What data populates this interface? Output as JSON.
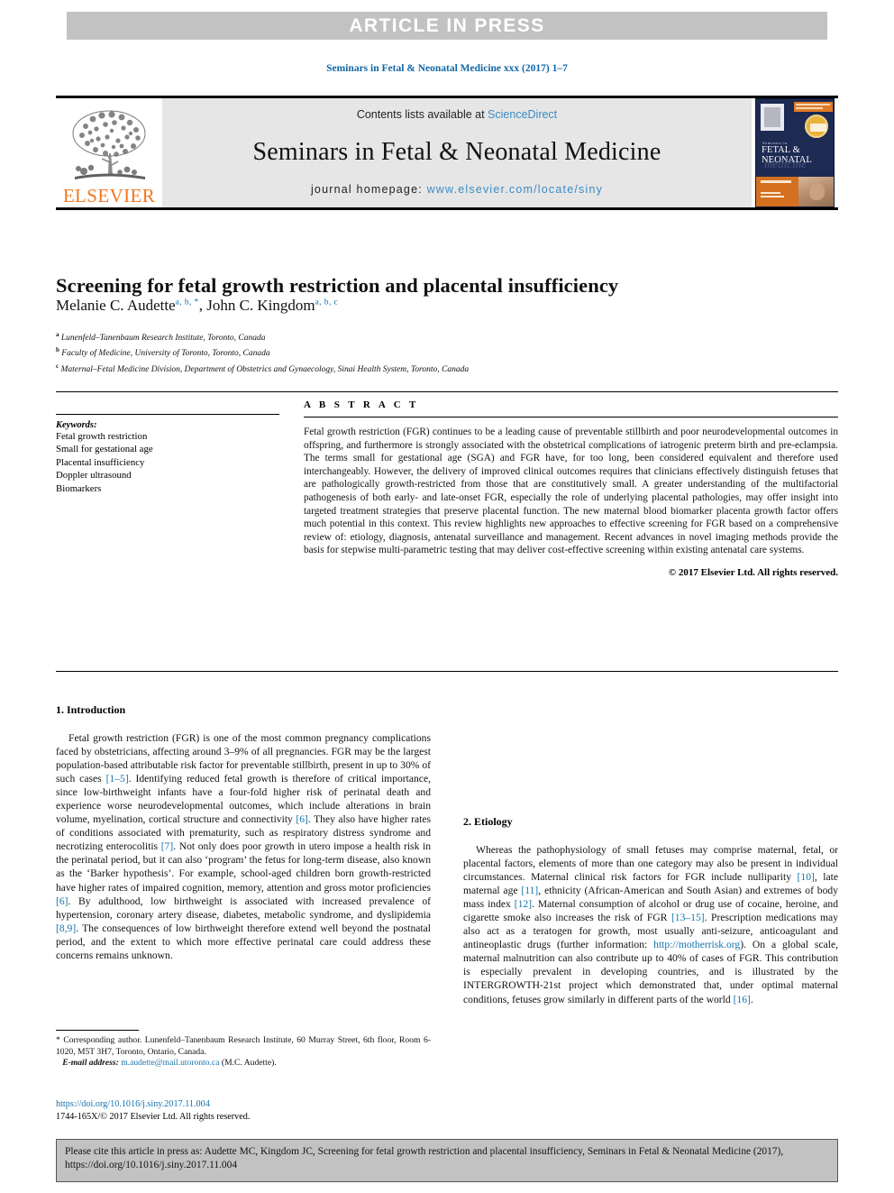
{
  "banner": {
    "label": "ARTICLE IN PRESS"
  },
  "journal_ref": "Seminars in Fetal & Neonatal Medicine xxx (2017) 1–7",
  "masthead": {
    "contents_prefix": "Contents lists available at ",
    "sciencedirect": "ScienceDirect",
    "journal_title": "Seminars in Fetal & Neonatal Medicine",
    "homepage_prefix": "journal homepage: ",
    "homepage_url": "www.elsevier.com/locate/siny",
    "publisher": "ELSEVIER",
    "cover": {
      "superline": "Seminars in",
      "title_line": "FETAL & NEONATAL",
      "script_line": "medicine"
    }
  },
  "article": {
    "title": "Screening for fetal growth restriction and placental insufficiency",
    "authors": [
      {
        "name": "Melanie C. Audette",
        "marks": "a, b, *"
      },
      {
        "name": "John C. Kingdom",
        "marks": "a, b, c"
      }
    ],
    "affiliations": [
      {
        "mark": "a",
        "text": "Lunenfeld–Tanenbaum Research Institute, Toronto, Canada"
      },
      {
        "mark": "b",
        "text": "Faculty of Medicine, University of Toronto, Toronto, Canada"
      },
      {
        "mark": "c",
        "text": "Maternal–Fetal Medicine Division, Department of Obstetrics and Gynaecology, Sinai Health System, Toronto, Canada"
      }
    ]
  },
  "keywords": {
    "heading": "Keywords:",
    "items": [
      "Fetal growth restriction",
      "Small for gestational age",
      "Placental insufficiency",
      "Doppler ultrasound",
      "Biomarkers"
    ]
  },
  "abstract": {
    "heading": "A B S T R A C T",
    "text": "Fetal growth restriction (FGR) continues to be a leading cause of preventable stillbirth and poor neurodevelopmental outcomes in offspring, and furthermore is strongly associated with the obstetrical complications of iatrogenic preterm birth and pre-eclampsia. The terms small for gestational age (SGA) and FGR have, for too long, been considered equivalent and therefore used interchangeably. However, the delivery of improved clinical outcomes requires that clinicians effectively distinguish fetuses that are pathologically growth-restricted from those that are constitutively small. A greater understanding of the multifactorial pathogenesis of both early- and late-onset FGR, especially the role of underlying placental pathologies, may offer insight into targeted treatment strategies that preserve placental function. The new maternal blood biomarker placenta growth factor offers much potential in this context. This review highlights new approaches to effective screening for FGR based on a comprehensive review of: etiology, diagnosis, antenatal surveillance and management. Recent advances in novel imaging methods provide the basis for stepwise multi-parametric testing that may deliver cost-effective screening within existing antenatal care systems.",
    "copyright": "© 2017 Elsevier Ltd. All rights reserved."
  },
  "sections": {
    "intro_heading": "1. Introduction",
    "etiology_heading": "2. Etiology"
  },
  "body": {
    "intro_p1_a": "Fetal growth restriction (FGR) is one of the most common pregnancy complications faced by obstetricians, affecting around 3–9% of all pregnancies. FGR may be the largest population-based attributable risk factor for preventable stillbirth, present in up to 30% of such cases ",
    "intro_p1_ref1": "[1–5]",
    "intro_p1_b": ". Identifying reduced fetal growth is therefore of critical importance, since low-birthweight infants have a four-fold higher risk of perinatal death and experience worse neurodevelopmental outcomes, which include alterations in brain volume, myelination, cortical structure and connectivity ",
    "intro_p1_ref2": "[6]",
    "intro_p1_c": ". They also have higher rates of conditions associated with prematurity, such as respiratory distress syndrome and necrotizing enterocolitis ",
    "intro_p1_ref3": "[7]",
    "intro_p1_d": ". Not only does poor growth in utero impose a health risk in the perinatal period, but it can also ‘program’ the fetus for long-term disease, also known as the ‘Barker hypothesis’. For example, school-aged children born growth-restricted have higher rates of impaired cognition, memory, attention and gross motor proficiencies ",
    "intro_p1_ref4": "[6]",
    "intro_p1_e": ". By adulthood, low birthweight is associated with increased prevalence of hypertension, coronary artery disease, diabetes, metabolic syndrome, and dyslipidemia ",
    "intro_p1_ref5": "[8,9]",
    "intro_p1_f": ". The consequences of low birthweight therefore extend well beyond the postnatal period, and the extent to which more effective perinatal care could address these concerns remains unknown.",
    "etiology_p1_a": "Whereas the pathophysiology of small fetuses may comprise maternal, fetal, or placental factors, elements of more than one category may also be present in individual circumstances. Maternal clinical risk factors for FGR include nulliparity ",
    "etiology_p1_ref1": "[10]",
    "etiology_p1_b": ", late maternal age ",
    "etiology_p1_ref2": "[11]",
    "etiology_p1_c": ", ethnicity (African-American and South Asian) and extremes of body mass index ",
    "etiology_p1_ref3": "[12]",
    "etiology_p1_d": ". Maternal consumption of alcohol or drug use of cocaine, heroine, and cigarette smoke also increases the risk of FGR ",
    "etiology_p1_ref4": "[13–15]",
    "etiology_p1_e": ". Prescription medications may also act as a teratogen for growth, most usually anti-seizure, anticoagulant and antineoplastic drugs (further information: ",
    "etiology_p1_link": "http://motherrisk.org",
    "etiology_p1_f": "). On a global scale, maternal malnutrition can also contribute up to 40% of cases of FGR. This contribution is especially prevalent in developing countries, and is illustrated by the INTERGROWTH-21st project which demonstrated that, under optimal maternal conditions, fetuses grow similarly in different parts of the world ",
    "etiology_p1_ref5": "[16]",
    "etiology_p1_g": "."
  },
  "footnote": {
    "star": "*",
    "corresponding": " Corresponding author. Lunenfeld–Tanenbaum Research Institute, 60 Murray Street, 6th floor, Room 6-1020, M5T 3H7, Toronto, Ontario, Canada.",
    "email_label": "E-mail address:",
    "email": "m.audette@mail.utoronto.ca",
    "email_suffix": " (M.C. Audette)."
  },
  "doi": {
    "url": "https://doi.org/10.1016/j.siny.2017.11.004",
    "issn_line": "1744-165X/© 2017 Elsevier Ltd. All rights reserved."
  },
  "cite_box": {
    "text": "Please cite this article in press as: Audette MC, Kingdom JC, Screening for fetal growth restriction and placental insufficiency, Seminars in Fetal & Neonatal Medicine (2017), https://doi.org/10.1016/j.siny.2017.11.004"
  },
  "colors": {
    "link_blue": "#1474ad",
    "sciencedirect_blue": "#3a8cc4",
    "elsevier_orange": "#f3761e",
    "banner_gray": "#c2c2c2",
    "masthead_gray": "#e6e6e6"
  }
}
